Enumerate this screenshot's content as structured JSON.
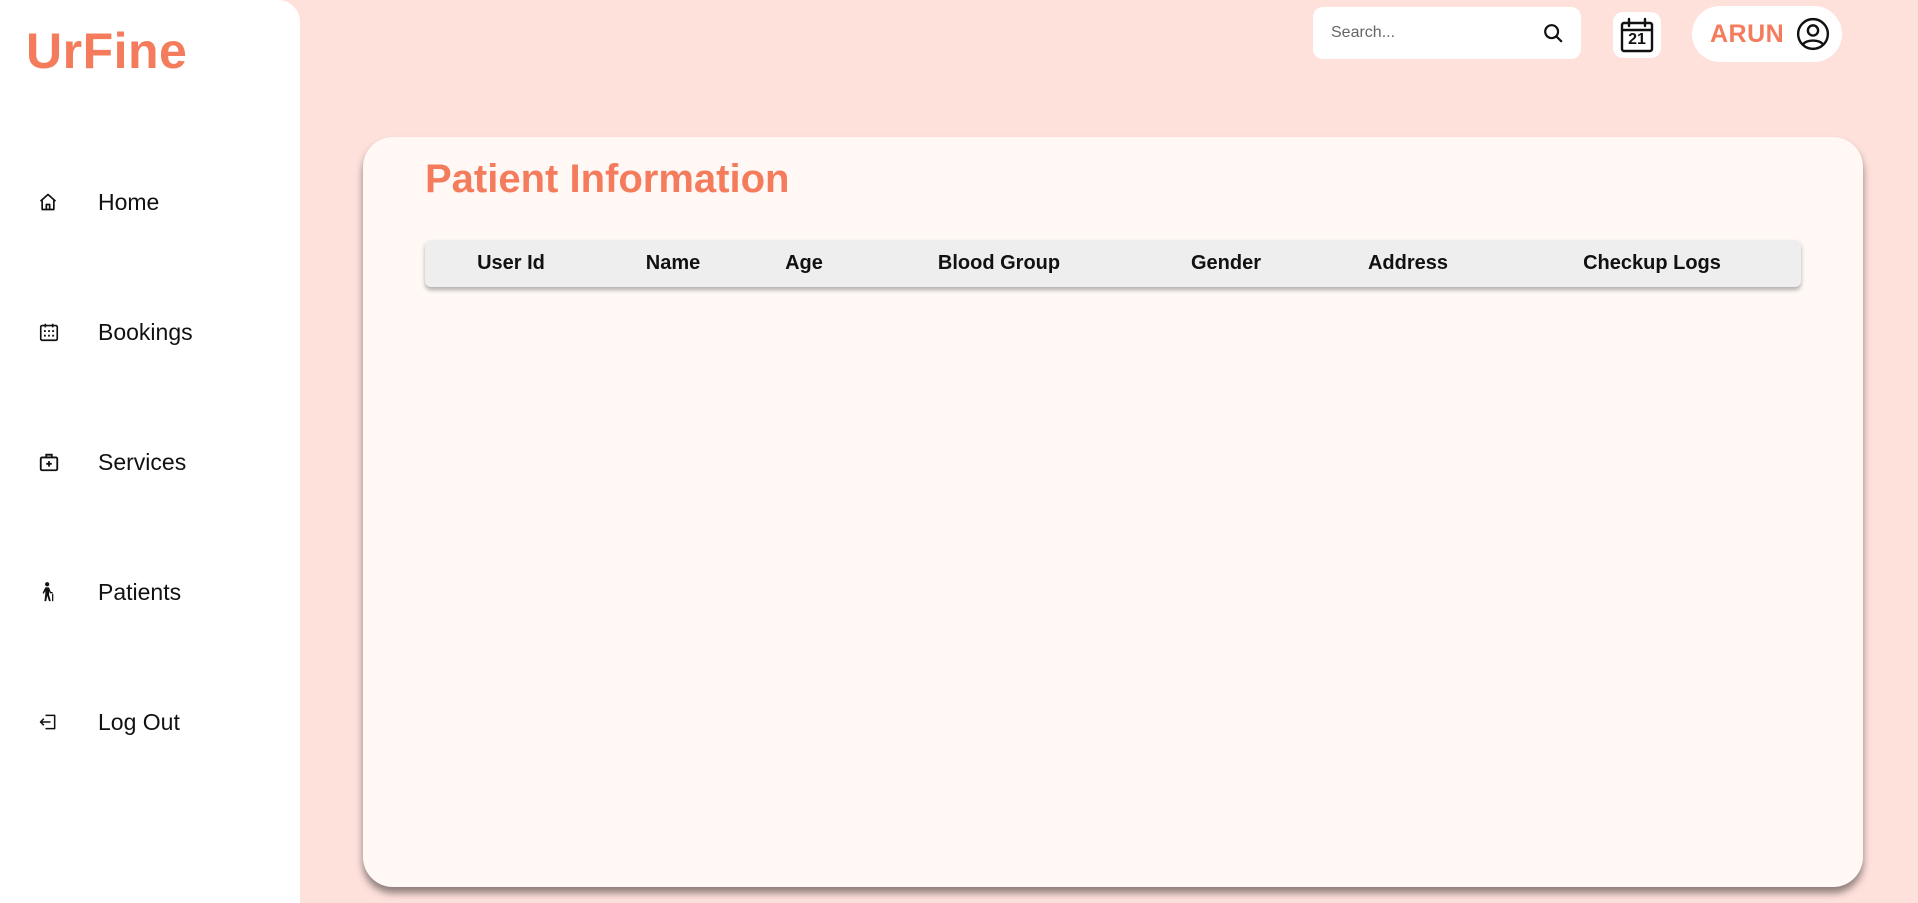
{
  "app": {
    "name": "UrFine",
    "accent_color": "#f47c5d",
    "background_color": "#ffe1dc"
  },
  "sidebar": {
    "items": [
      {
        "label": "Home",
        "icon": "home-icon"
      },
      {
        "label": "Bookings",
        "icon": "calendar-grid-icon"
      },
      {
        "label": "Services",
        "icon": "medical-bag-icon"
      },
      {
        "label": "Patients",
        "icon": "elderly-person-icon"
      },
      {
        "label": "Log Out",
        "icon": "logout-icon"
      }
    ]
  },
  "header": {
    "search": {
      "placeholder": "Search...",
      "value": "",
      "icon": "search-icon"
    },
    "calendar": {
      "icon": "calendar-icon",
      "day": "21"
    },
    "user": {
      "name": "ARUN",
      "icon": "user-circle-icon"
    }
  },
  "main": {
    "title": "Patient Information",
    "table": {
      "columns": [
        "User Id",
        "Name",
        "Age",
        "Blood Group",
        "Gender",
        "Address",
        "Checkup Logs"
      ],
      "rows": []
    }
  }
}
